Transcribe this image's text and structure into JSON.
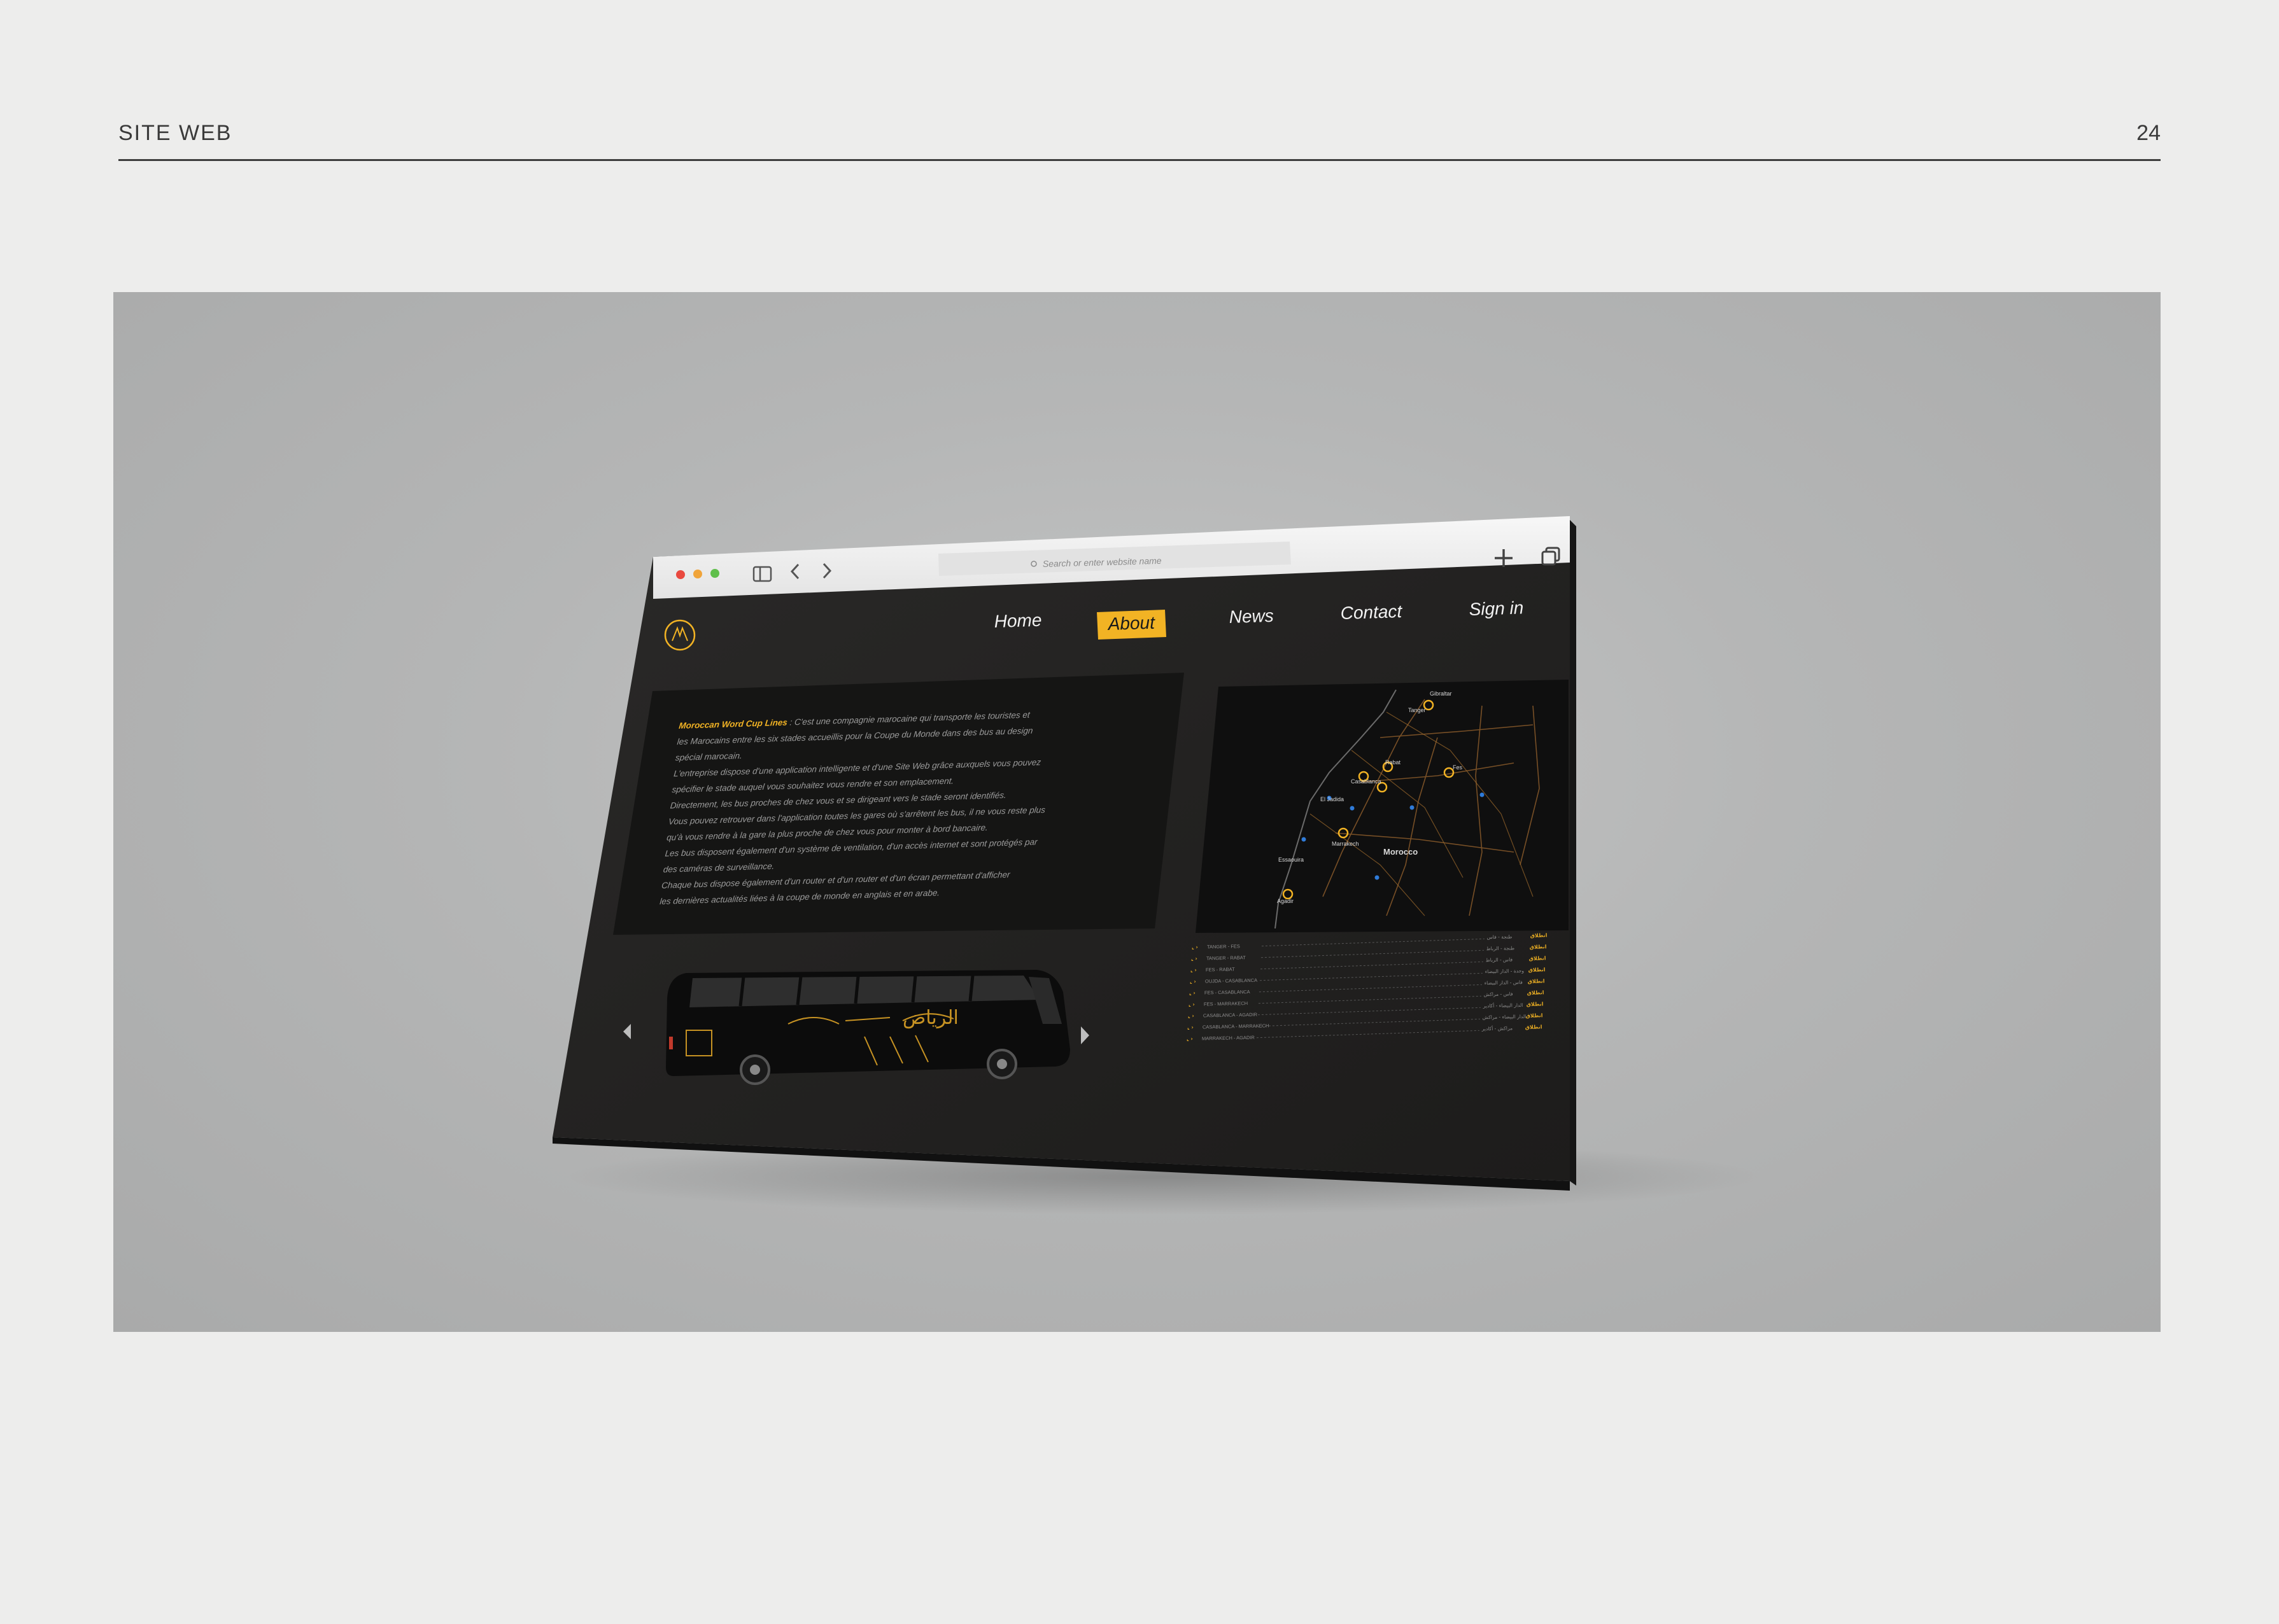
{
  "document": {
    "section_title": "SITE WEB",
    "page_number": "24"
  },
  "browser": {
    "url_placeholder": "Search or enter website name",
    "traffic_lights": {
      "close": "#e9493f",
      "minimize": "#f0a43a",
      "maximize": "#5fbf4b"
    },
    "icons": [
      "sidebar-icon",
      "back-icon",
      "forward-icon",
      "search-icon",
      "new-tab-icon",
      "tabs-overview-icon"
    ]
  },
  "site": {
    "accent_color": "#f2b324",
    "background_color": "#222120",
    "nav": [
      {
        "label": "Home",
        "active": false
      },
      {
        "label": "About",
        "active": true
      },
      {
        "label": "News",
        "active": false
      },
      {
        "label": "Contact",
        "active": false
      },
      {
        "label": "Sign in",
        "active": false
      }
    ],
    "about": {
      "brand": "Moroccan Word Cup Lines",
      "lines": [
        " : C'est une compagnie marocaine qui transporte les touristes et",
        "les Marocains entre les six stades accueillis pour la Coupe du Monde dans des bus au design",
        "spécial marocain.",
        "L'entreprise dispose d'une application intelligente et d'une Site Web grâce auxquels vous pouvez",
        "spécifier le stade auquel vous souhaitez vous rendre et son emplacement.",
        "Directement, les bus proches de chez vous et se dirigeant vers le stade seront identifiés.",
        "Vous pouvez retrouver dans l'application toutes les gares où s'arrêtent les bus, il ne vous reste plus",
        "qu'à vous rendre à la gare la plus proche de chez vous pour monter à bord bancaire.",
        "Les bus disposent également d'un système de ventilation, d'un accès internet et sont protégés par",
        "des caméras de surveillance.",
        "Chaque bus dispose également d'un router et d'un router et d'un écran permettant d'afficher",
        "les dernières actualités liées à la coupe de monde en anglais et en arabe."
      ]
    },
    "map": {
      "labels": [
        "Gibraltar",
        "Tanger",
        "Casablanca",
        "Rabat",
        "Fes",
        "El Jadida",
        "Marrakech",
        "Morocco",
        "Essaouira",
        "Agadir"
      ]
    },
    "routes": [
      {
        "route": "TANGER - FES",
        "ar": "طنجة - فاس",
        "action": "انطلاق"
      },
      {
        "route": "TANGER - RABAT",
        "ar": "طنجة - الرباط",
        "action": "انطلاق"
      },
      {
        "route": "FES - RABAT",
        "ar": "فاس - الرباط",
        "action": "انطلاق"
      },
      {
        "route": "OUJDA - CASABLANCA",
        "ar": "وجدة - الدار البيضاء",
        "action": "انطلاق"
      },
      {
        "route": "FES - CASABLANCA",
        "ar": "فاس - الدار البيضاء",
        "action": "انطلاق"
      },
      {
        "route": "FES - MARRAKECH",
        "ar": "فاس - مراكش",
        "action": "انطلاق"
      },
      {
        "route": "CASABLANCA - AGADIR",
        "ar": "الدار البيضاء - أكادير",
        "action": "انطلاق"
      },
      {
        "route": "CASABLANCA - MARRAKECH",
        "ar": "الدار البيضاء - مراكش",
        "action": "انطلاق"
      },
      {
        "route": "MARRAKECH - AGADIR",
        "ar": "مراكش - أكادير",
        "action": "انطلاق"
      }
    ],
    "bus": {
      "livery_text": "الرياض"
    }
  }
}
